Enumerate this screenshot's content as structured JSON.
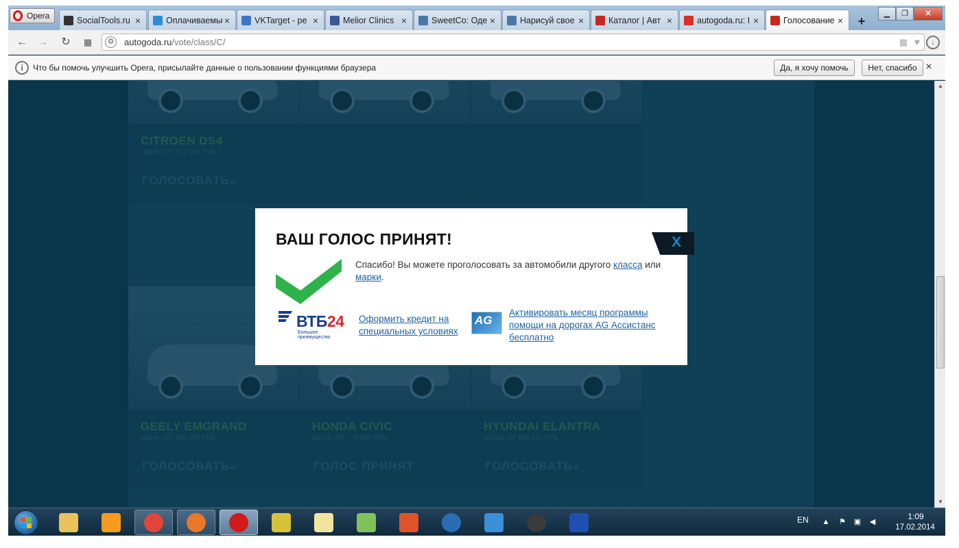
{
  "browser": {
    "menu_label": "Opera",
    "tabs": [
      {
        "title": "SocialTools.ru",
        "icon": "socialtools-icon",
        "color": "#333333",
        "active": false
      },
      {
        "title": "Оплачиваемые",
        "icon": "oplata-icon",
        "color": "#2b8fd6",
        "active": false
      },
      {
        "title": "VKTarget - ре",
        "icon": "vktarget-icon",
        "color": "#3a77c7",
        "active": false
      },
      {
        "title": "Melior Clinics",
        "icon": "facebook-icon",
        "color": "#3b5998",
        "active": false
      },
      {
        "title": "SweetCo: Оде",
        "icon": "vk-icon",
        "color": "#4a76a8",
        "active": false
      },
      {
        "title": "Нарисуй свое",
        "icon": "vk-icon",
        "color": "#4a76a8",
        "active": false
      },
      {
        "title": "Каталог | Авт",
        "icon": "autogoda-icon",
        "color": "#c8281c",
        "active": false
      },
      {
        "title": "autogoda.ru: I",
        "icon": "gmail-icon",
        "color": "#d93025",
        "active": false
      },
      {
        "title": "Голосование",
        "icon": "autogoda-icon",
        "color": "#c8281c",
        "active": true
      }
    ],
    "new_tab_label": "+",
    "url_host": "autogoda.ru",
    "url_path": "/vote/class/C/",
    "infobar": {
      "text": "Что бы помочь улучшить Opera, присылайте данные о пользовании функциями браузера",
      "yes_label": "Да, я хочу помочь",
      "no_label": "Нет, спасибо",
      "close_label": "×",
      "info_glyph": "i"
    }
  },
  "page": {
    "cars": [
      {
        "name": "CITROEN DS4",
        "price": "ЦЕНА: ОТ 777 000 РУБ.",
        "vote": "ГОЛОСОВАТЬ»"
      },
      {
        "name": "",
        "price": "",
        "vote": ""
      },
      {
        "name": "",
        "price": "",
        "vote": ""
      },
      {
        "name": "GEELY EMGRAND",
        "price": "ЦЕНА: ОТ 439 000 РУБ.",
        "vote": "ГОЛОСОВАТЬ»"
      },
      {
        "name": "HONDA CIVIC",
        "price": "ЦЕНА: ОТ 779 000 РУБ.",
        "vote": "ГОЛОС ПРИНЯТ"
      },
      {
        "name": "HYUNDAI ELANTRA",
        "price": "ЦЕНА: ОТ 699 000 РУБ.",
        "vote": "ГОЛОСОВАТЬ»"
      }
    ],
    "modal": {
      "title": "ВАШ ГОЛОС ПРИНЯТ!",
      "close_label": "X",
      "message_before": "Спасибо! Вы можете проголосовать за автомобили другого ",
      "link_class": "класса",
      "message_middle": " или ",
      "link_brands": "марки",
      "message_after": ".",
      "vtb_brand": "ВТБ",
      "vtb_number": "24",
      "vtb_slogan": "Большое преимущество",
      "vtb_link": "Оформить кредит на специальных условиях",
      "ag_brand": "AG",
      "ag_link": "Активировать месяц программы помощи на дорогах AG Ассистанс бесплатно",
      "accent_color": "#2db34a"
    }
  },
  "taskbar": {
    "apps": [
      {
        "name": "explorer-icon",
        "color": "#e8c25a",
        "state": "none"
      },
      {
        "name": "media-player-icon",
        "color": "#f39c1f",
        "state": "none"
      },
      {
        "name": "chrome-icon",
        "color": "#e0463a",
        "state": "running"
      },
      {
        "name": "firefox-icon",
        "color": "#e8782a",
        "state": "running"
      },
      {
        "name": "opera-icon",
        "color": "#d21b1b",
        "state": "active"
      },
      {
        "name": "tool-icon",
        "color": "#d6c23a",
        "state": "none"
      },
      {
        "name": "paint-icon",
        "color": "#f1e3a0",
        "state": "none"
      },
      {
        "name": "notepad-icon",
        "color": "#7fc15a",
        "state": "none"
      },
      {
        "name": "power-app-icon",
        "color": "#e0522a",
        "state": "none"
      },
      {
        "name": "power-button-icon",
        "color": "#2a6db5",
        "state": "none"
      },
      {
        "name": "sync-icon",
        "color": "#3a8fd6",
        "state": "none"
      },
      {
        "name": "steam-icon",
        "color": "#3b3b3b",
        "state": "none"
      },
      {
        "name": "save-disk-icon",
        "color": "#1f4fb0",
        "state": "none"
      }
    ],
    "language": "EN",
    "time": "1:09",
    "date": "17.02.2014"
  }
}
